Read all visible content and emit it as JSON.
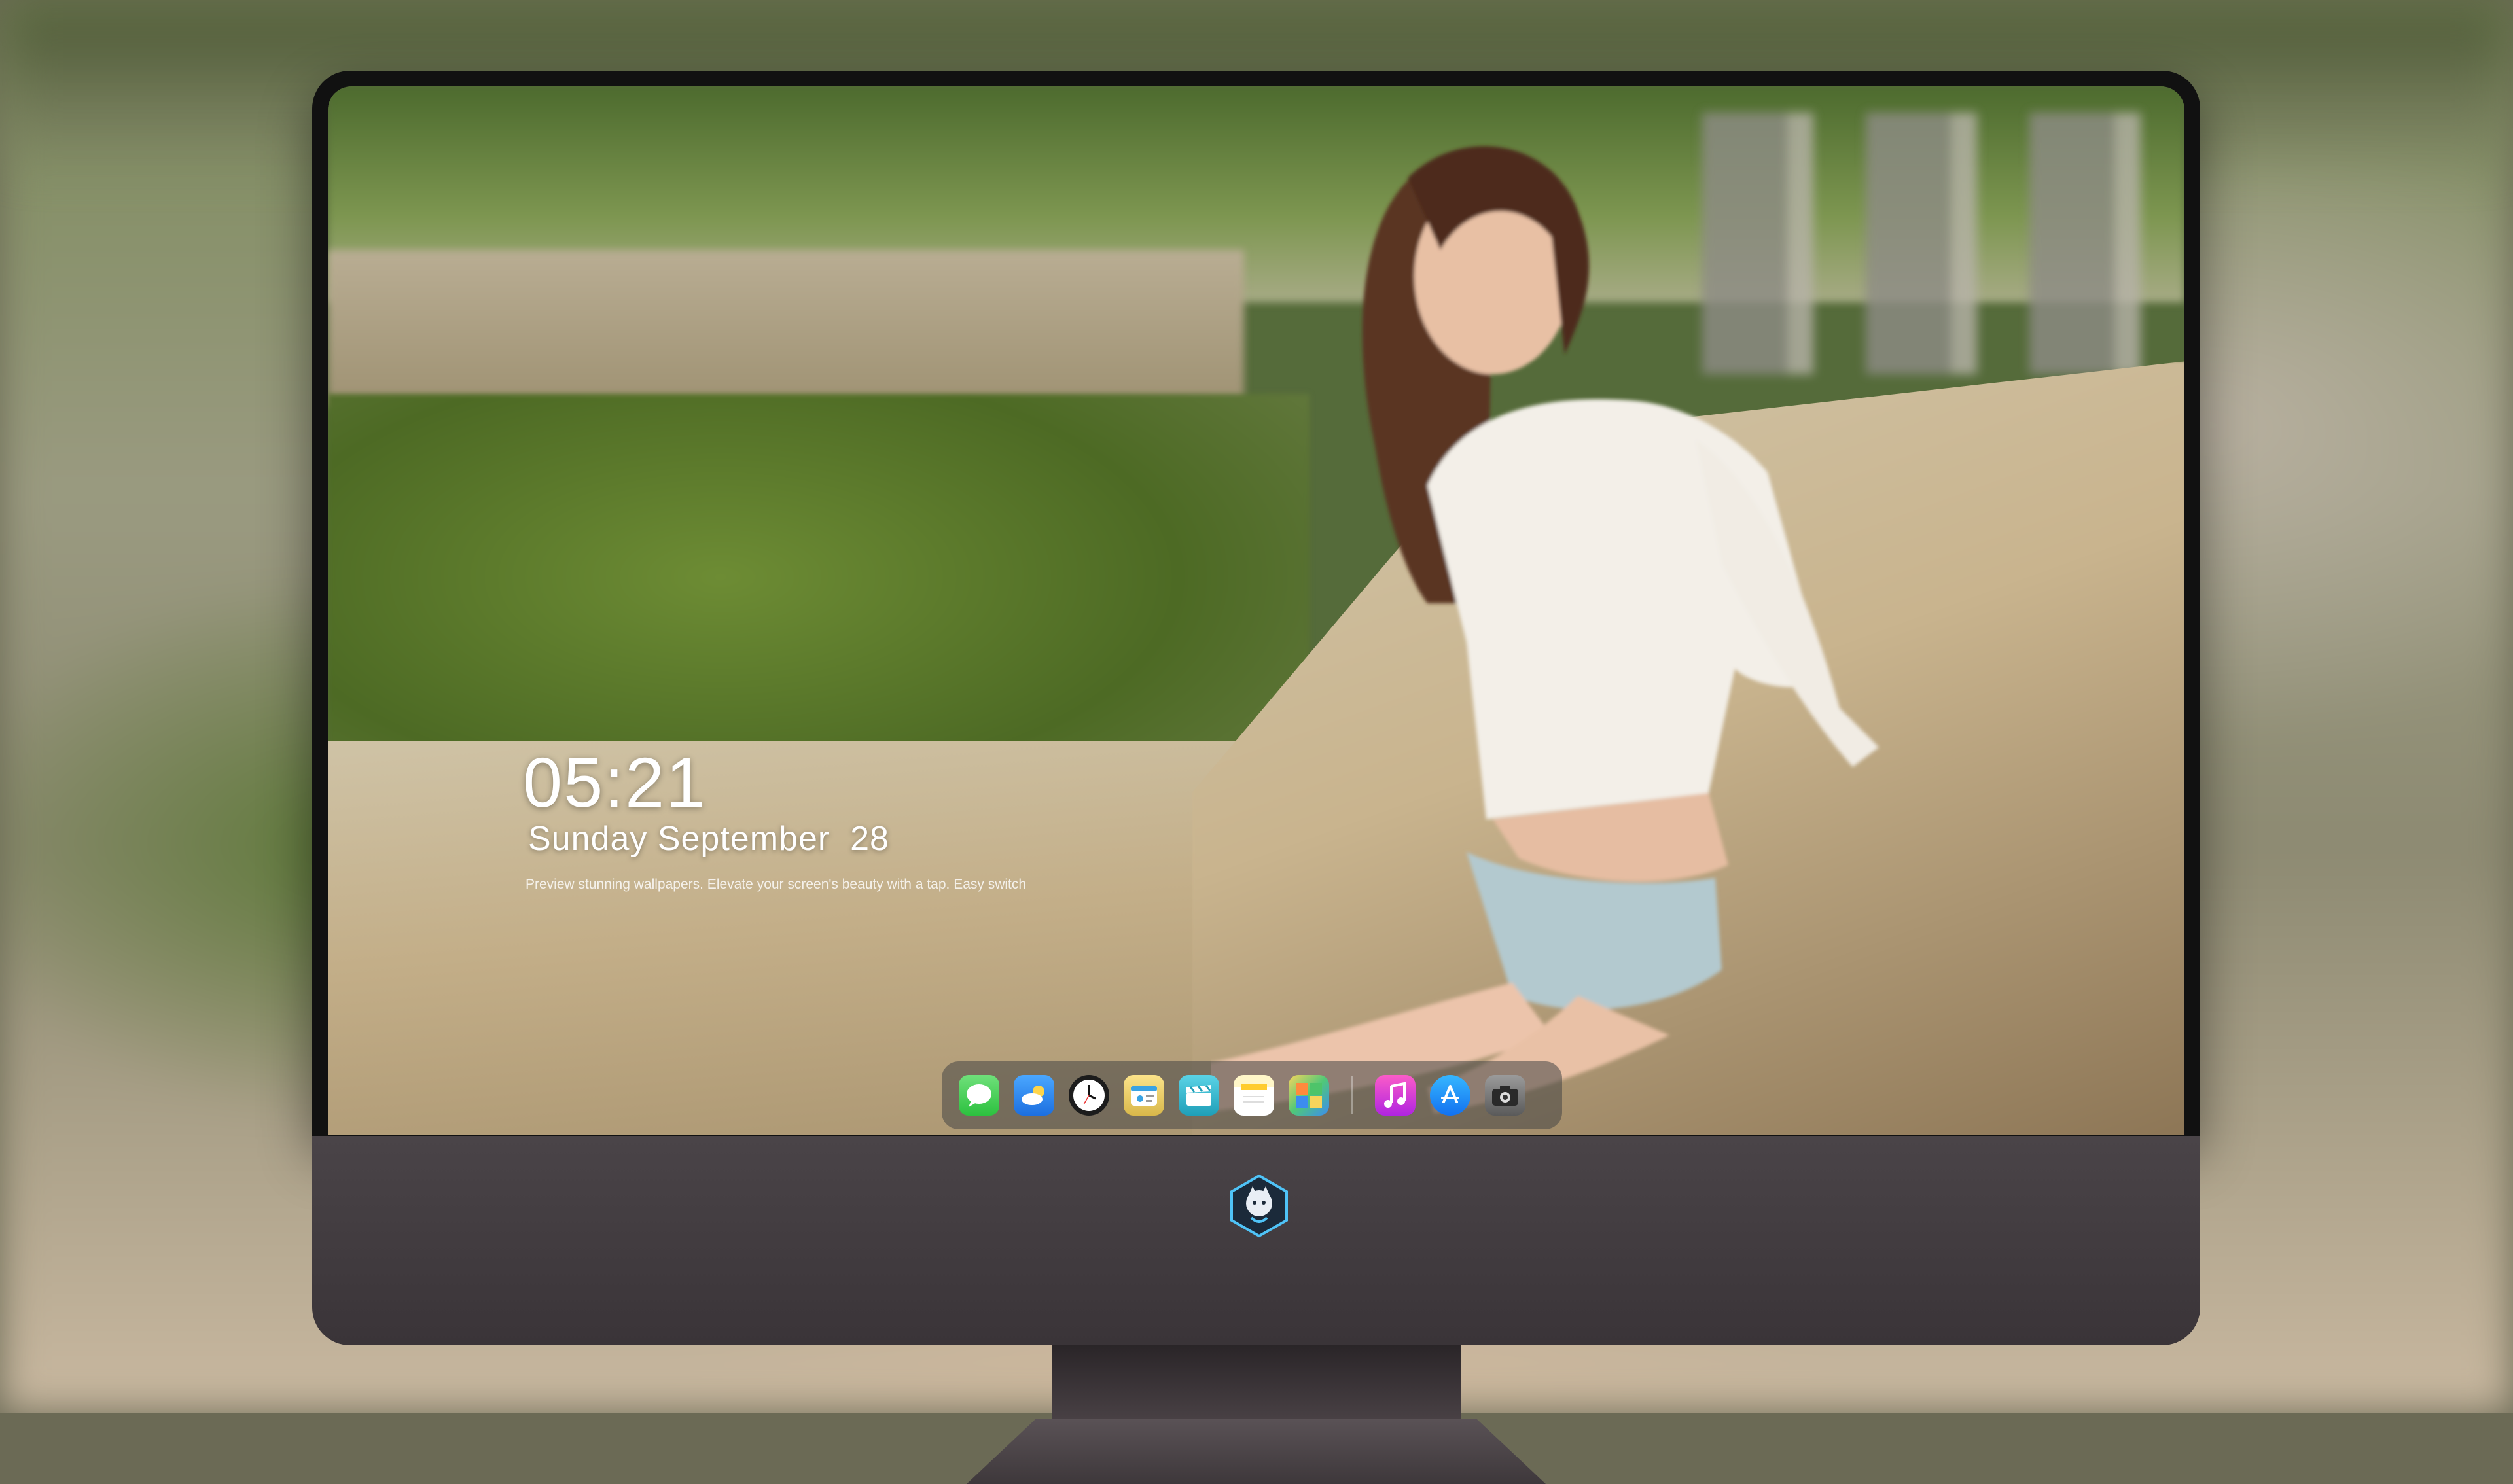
{
  "lock_screen": {
    "time": "05:21",
    "date": "Sunday September  28",
    "tagline": "Preview stunning wallpapers. Elevate your screen's beauty with a tap. Easy switch"
  },
  "dock": {
    "apps": [
      {
        "name": "Messages",
        "icon": "messages-icon"
      },
      {
        "name": "Weather",
        "icon": "weather-icon"
      },
      {
        "name": "Clock",
        "icon": "clock-icon"
      },
      {
        "name": "Finder",
        "icon": "finder-icon"
      },
      {
        "name": "Clips",
        "icon": "clips-icon"
      },
      {
        "name": "Notes",
        "icon": "notes-icon"
      },
      {
        "name": "Photo Browser",
        "icon": "photos-icon"
      },
      {
        "name": "Music",
        "icon": "music-icon"
      },
      {
        "name": "App Store",
        "icon": "app-store-icon"
      },
      {
        "name": "Camera",
        "icon": "camera-icon"
      }
    ]
  },
  "colors": {
    "bezel": "#111111",
    "chin": "#433d41",
    "dock_background": "#464646",
    "text": "#ffffff"
  }
}
